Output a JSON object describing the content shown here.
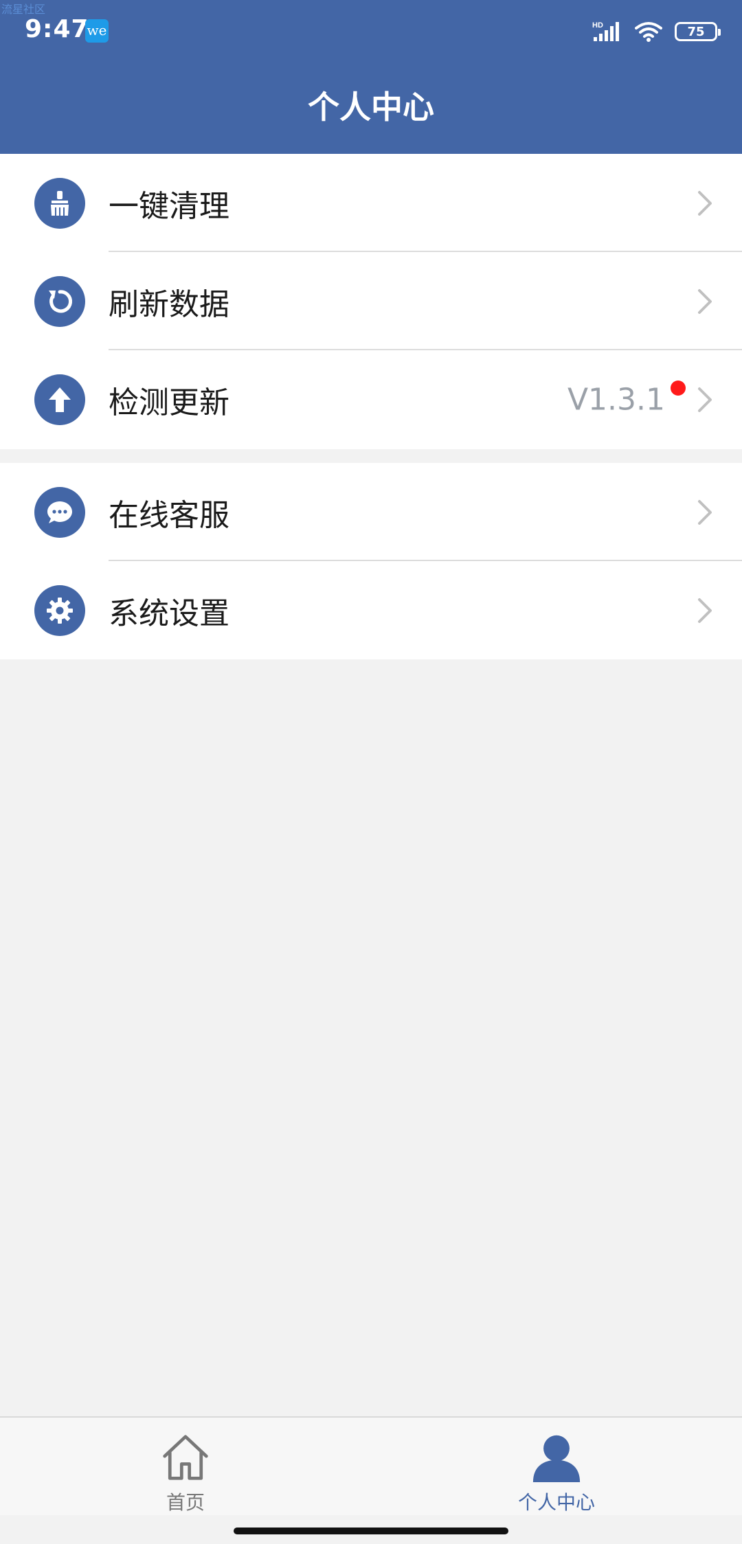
{
  "watermark": "流星社区",
  "status_bar": {
    "time": "9:47",
    "app_badge": "we",
    "network_label": "HD",
    "battery": "75"
  },
  "header": {
    "title": "个人中心"
  },
  "menu_groups": [
    {
      "items": [
        {
          "label": "一键清理",
          "icon": "broom-icon"
        },
        {
          "label": "刷新数据",
          "icon": "refresh-icon"
        },
        {
          "label": "检测更新",
          "icon": "upload-arrow-icon",
          "value": "V1.3.1",
          "has_badge": true
        }
      ]
    },
    {
      "items": [
        {
          "label": "在线客服",
          "icon": "chat-bubble-icon"
        },
        {
          "label": "系统设置",
          "icon": "gear-icon"
        }
      ]
    }
  ],
  "tabbar": {
    "tabs": [
      {
        "label": "首页",
        "icon": "home-icon",
        "active": false
      },
      {
        "label": "个人中心",
        "icon": "person-icon",
        "active": true
      }
    ]
  },
  "colors": {
    "primary": "#4366a6",
    "badge": "#ff1a1a",
    "background": "#f2f2f2"
  }
}
